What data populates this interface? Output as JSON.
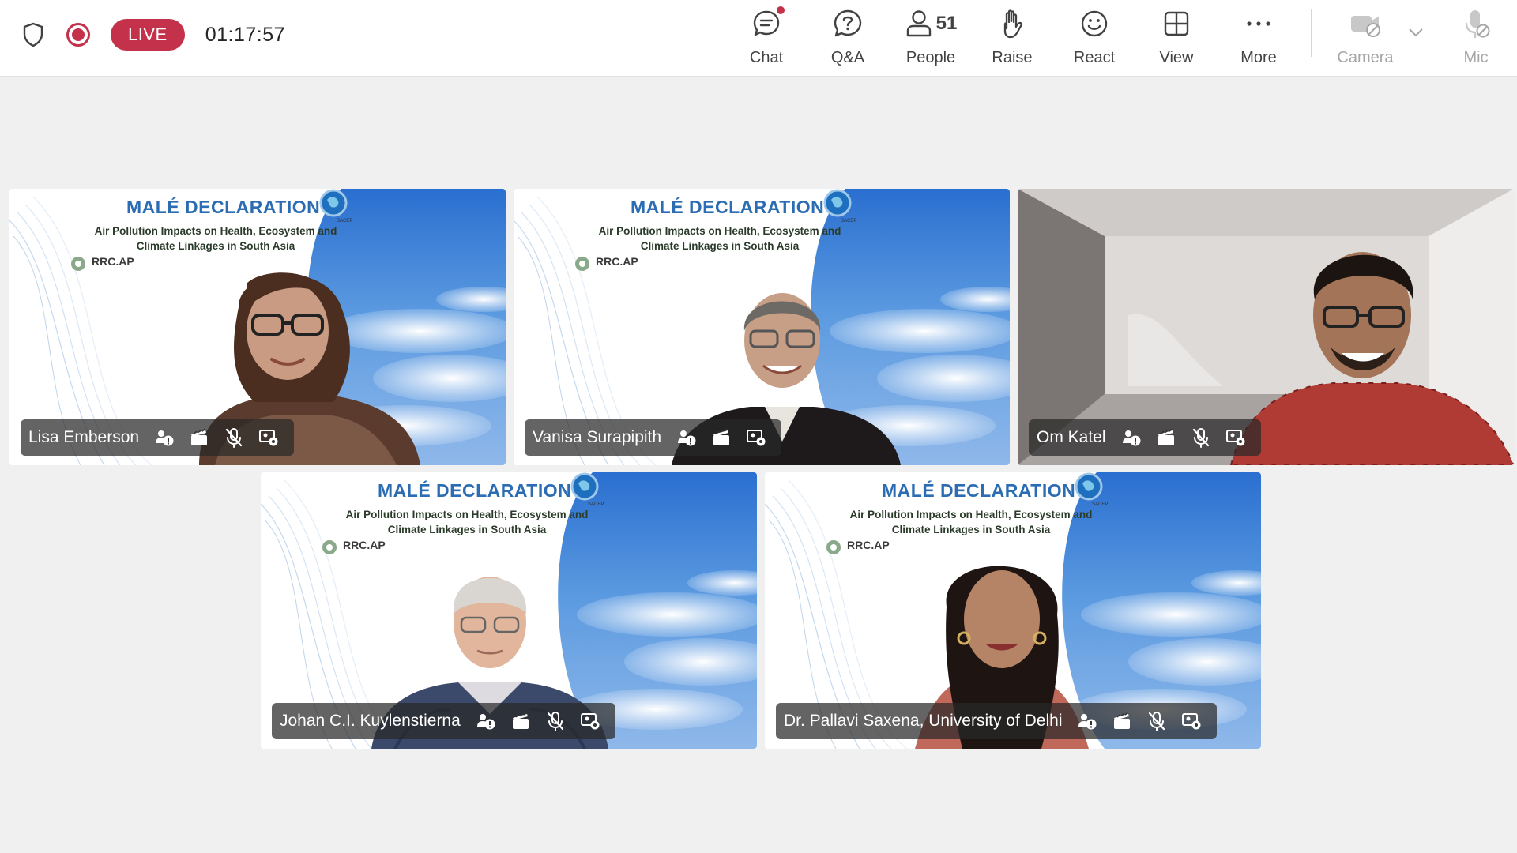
{
  "status": {
    "live_label": "LIVE",
    "elapsed": "01:17:57",
    "live_color": "#c4314b"
  },
  "toolbar": {
    "chat": {
      "label": "Chat",
      "icon": "chat-icon",
      "has_notification": true
    },
    "qa": {
      "label": "Q&A",
      "icon": "qa-icon"
    },
    "people": {
      "label": "People",
      "icon": "people-icon",
      "count": "51"
    },
    "raise": {
      "label": "Raise",
      "icon": "hand-icon"
    },
    "react": {
      "label": "React",
      "icon": "smiley-icon"
    },
    "view": {
      "label": "View",
      "icon": "grid-icon"
    },
    "more": {
      "label": "More",
      "icon": "ellipsis-icon"
    },
    "camera": {
      "label": "Camera",
      "icon": "camera-off-icon",
      "disabled": true
    },
    "mic": {
      "label": "Mic",
      "icon": "mic-off-icon",
      "disabled": true
    }
  },
  "slide": {
    "title": "MALÉ DECLARATION",
    "subtitle_line1": "Air Pollution Impacts on Health, Ecosystem and",
    "subtitle_line2": "Climate Linkages in South Asia",
    "logo_text": "RRC.AP",
    "badge_text": "SACEP"
  },
  "participants": [
    {
      "name": "Lisa Emberson",
      "muted": true,
      "background": "slide"
    },
    {
      "name": "Vanisa Surapipith",
      "muted": false,
      "background": "slide"
    },
    {
      "name": "Om Katel",
      "muted": true,
      "background": "room"
    },
    {
      "name": "Johan C.I. Kuylenstierna",
      "muted": true,
      "background": "slide"
    },
    {
      "name": "Dr. Pallavi Saxena, University of Delhi",
      "muted": true,
      "background": "slide"
    }
  ],
  "colors": {
    "accent": "#c4314b",
    "toolbar_bg": "#ffffff",
    "stage_bg": "#f0f0f0",
    "slide_title": "#2b6cb3"
  }
}
